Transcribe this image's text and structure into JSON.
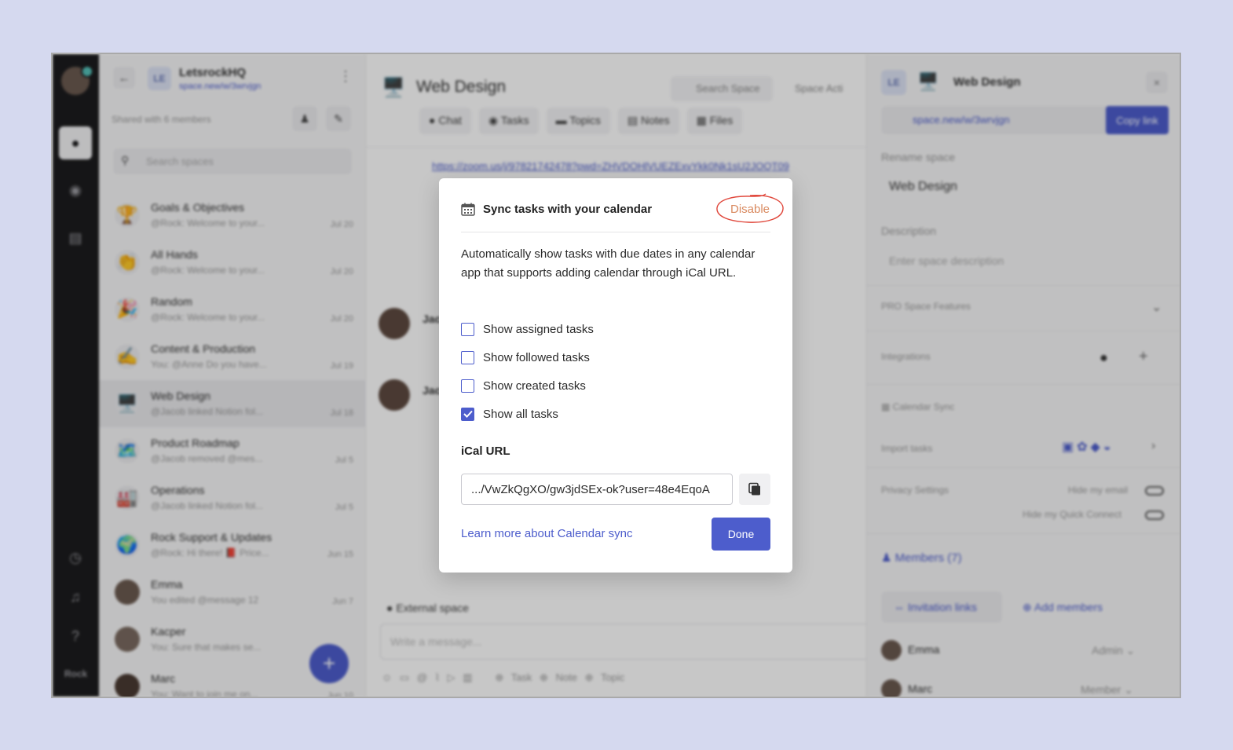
{
  "rail": {
    "label": "Rock"
  },
  "sidebar": {
    "workspace_logo": "LE",
    "workspace_name": "LetsrockHQ",
    "workspace_link": "space.new/w/3wrvjgn",
    "shared_text": "Shared with 6 members",
    "search_placeholder": "Search spaces",
    "spaces": [
      {
        "emoji": "🏆",
        "name": "Goals & Objectives",
        "preview": "@Rock: Welcome to your...",
        "date": "Jul 20"
      },
      {
        "emoji": "👏",
        "name": "All Hands",
        "preview": "@Rock: Welcome to your...",
        "date": "Jul 20"
      },
      {
        "emoji": "🎉",
        "name": "Random",
        "preview": "@Rock: Welcome to your...",
        "date": "Jul 20"
      },
      {
        "emoji": "✍️",
        "name": "Content & Production",
        "preview": "You: @Anne Do you have...",
        "date": "Jul 19"
      },
      {
        "emoji": "🖥️",
        "name": "Web Design",
        "preview": "@Jacob linked Notion fol...",
        "date": "Jul 18"
      },
      {
        "emoji": "🗺️",
        "name": "Product Roadmap",
        "preview": "@Jacob removed @mes...",
        "date": "Jul 5"
      },
      {
        "emoji": "🏭",
        "name": "Operations",
        "preview": "@Jacob linked Notion fol...",
        "date": "Jul 5"
      },
      {
        "emoji": "🌍",
        "name": "Rock Support & Updates",
        "preview": "@Rock: Hi there! 📕 Price...",
        "date": "Jun 15"
      },
      {
        "emoji": "",
        "name": "Emma",
        "preview": "You edited @message 12",
        "date": "Jun 7"
      },
      {
        "emoji": "",
        "name": "Kacper",
        "preview": "You: Sure that makes se...",
        "date": ""
      },
      {
        "emoji": "",
        "name": "Marc",
        "preview": "You: Want to join me on...",
        "date": "Jun 10"
      }
    ]
  },
  "main": {
    "icon": "🖥️",
    "title": "Web Design",
    "search_label": "Search Space",
    "activity_label": "Space Acti",
    "tabs": [
      {
        "icon": "●",
        "label": "Chat"
      },
      {
        "icon": "◉",
        "label": "Tasks"
      },
      {
        "icon": "▬",
        "label": "Topics"
      },
      {
        "icon": "▤",
        "label": "Notes"
      },
      {
        "icon": "▦",
        "label": "Files"
      }
    ],
    "zoom_link": "https://zoom.us/j/97821742478?pwd=ZHVDOHlVUEZExvYkk0Nk1sU2JOQT09",
    "msg_names": [
      "Jac",
      "Jac"
    ],
    "external_space": "External space",
    "composer_placeholder": "Write a message...",
    "composer_tools": [
      "Task",
      "Note",
      "Topic"
    ]
  },
  "rpanel": {
    "logo": "LE",
    "icon": "🖥️",
    "title": "Web Design",
    "link": "space.new/w/3wrvjgn",
    "copy_label": "Copy link",
    "rename_label": "Rename space",
    "rename_value": "Web Design",
    "desc_label": "Description",
    "desc_placeholder": "Enter space description",
    "pro_features": "PRO Space Features",
    "integrations": "Integrations",
    "calendar_sync": "Calendar Sync",
    "import_tasks": "Import tasks",
    "privacy": "Privacy Settings",
    "hide_email": "Hide my email",
    "hide_quick": "Hide my Quick Connect",
    "members": "Members (7)",
    "invitation_links": "Invitation links",
    "add_members": "Add members",
    "member_list": [
      {
        "name": "Emma",
        "role": "Admin"
      },
      {
        "name": "Marc",
        "role": "Member"
      }
    ]
  },
  "modal": {
    "title": "Sync tasks with your calendar",
    "disable_label": "Disable",
    "description": "Automatically show tasks with due dates in any calendar app that supports adding calendar through iCal URL.",
    "options": [
      {
        "label": "Show assigned tasks",
        "checked": false
      },
      {
        "label": "Show followed tasks",
        "checked": false
      },
      {
        "label": "Show created tasks",
        "checked": false
      },
      {
        "label": "Show all tasks",
        "checked": true
      }
    ],
    "ical_label": "iCal URL",
    "ical_value": ".../VwZkQgXO/gw3jdSEx-ok?user=48e4EqoA",
    "learn_more": "Learn more about Calendar sync",
    "done_label": "Done"
  },
  "colors": {
    "accent": "#4d5dcc",
    "disable": "#d98a60",
    "annotation_ring": "#e0463a",
    "backdrop": "#d5d9ef"
  }
}
